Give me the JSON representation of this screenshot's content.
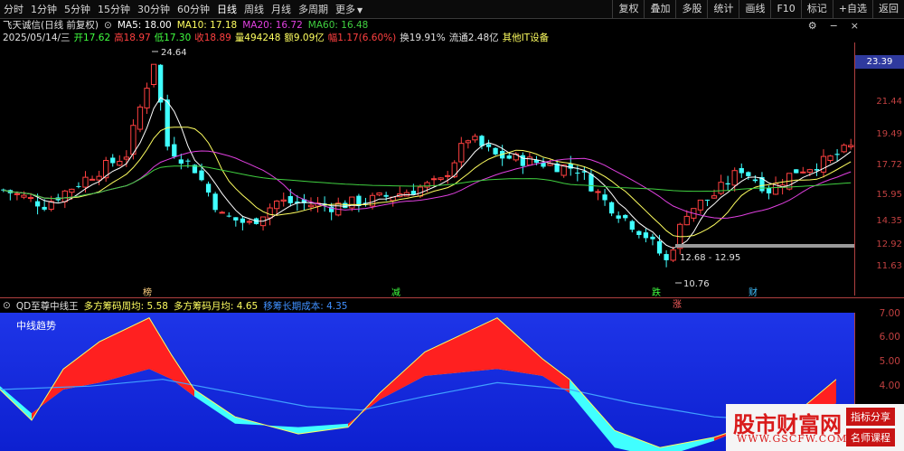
{
  "toolbar": {
    "periods": [
      "分时",
      "1分钟",
      "5分钟",
      "15分钟",
      "30分钟",
      "60分钟",
      "日线",
      "周线",
      "月线",
      "多周期",
      "更多"
    ],
    "active_index": 6,
    "right_buttons": [
      "复权",
      "叠加",
      "多股",
      "统计",
      "画线",
      "F10",
      "标记",
      "+自选",
      "返回"
    ]
  },
  "info1": {
    "stock": "飞天诚信(日线 前复权)",
    "ma5": "MA5: 18.00",
    "ma10": "MA10: 17.18",
    "ma20": "MA20: 16.72",
    "ma60": "MA60: 16.48"
  },
  "info2": {
    "date": "2025/05/14/三",
    "open": "开17.62",
    "high": "高18.97",
    "low": "低17.30",
    "close": "收18.89",
    "vol": "量494248",
    "amt": "额9.09亿",
    "chg": "幅1.17(6.60%)",
    "turn": "换19.91%",
    "float": "流通2.48亿",
    "sector": "其他IT设备"
  },
  "corner_icons": [
    "gear-icon",
    "minus-icon",
    "close-icon"
  ],
  "price_axis": {
    "ticks": [
      "21.44",
      "19.49",
      "17.72",
      "15.95",
      "14.35",
      "12.92",
      "11.63"
    ],
    "current": "23.39"
  },
  "annotations": {
    "high": "24.64",
    "low": "10.76",
    "range": "12.68 - 12.95"
  },
  "markers": {
    "m1": "榜",
    "m2": "减",
    "m3": "跌",
    "m4": "涨",
    "m5": "财"
  },
  "indicator": {
    "name": "QD至尊中线王",
    "wk": "多方筹码周均: 5.58",
    "mo": "多方筹码月均: 4.65",
    "lt": "移筹长期成本: 4.35",
    "trend": "中线趋势",
    "ticks": [
      "7.00",
      "6.00",
      "5.00",
      "4.00"
    ]
  },
  "watermark": {
    "main": "股市财富网",
    "url": "WWW.GSCFW.COM",
    "tag1": "指标分享",
    "tag2": "名师课程"
  },
  "colors": {
    "up": "#ff4040",
    "down": "#40ffff",
    "ma5": "#ffffff",
    "ma10": "#ffff60",
    "ma20": "#e040e0",
    "ma60": "#40d040"
  }
}
